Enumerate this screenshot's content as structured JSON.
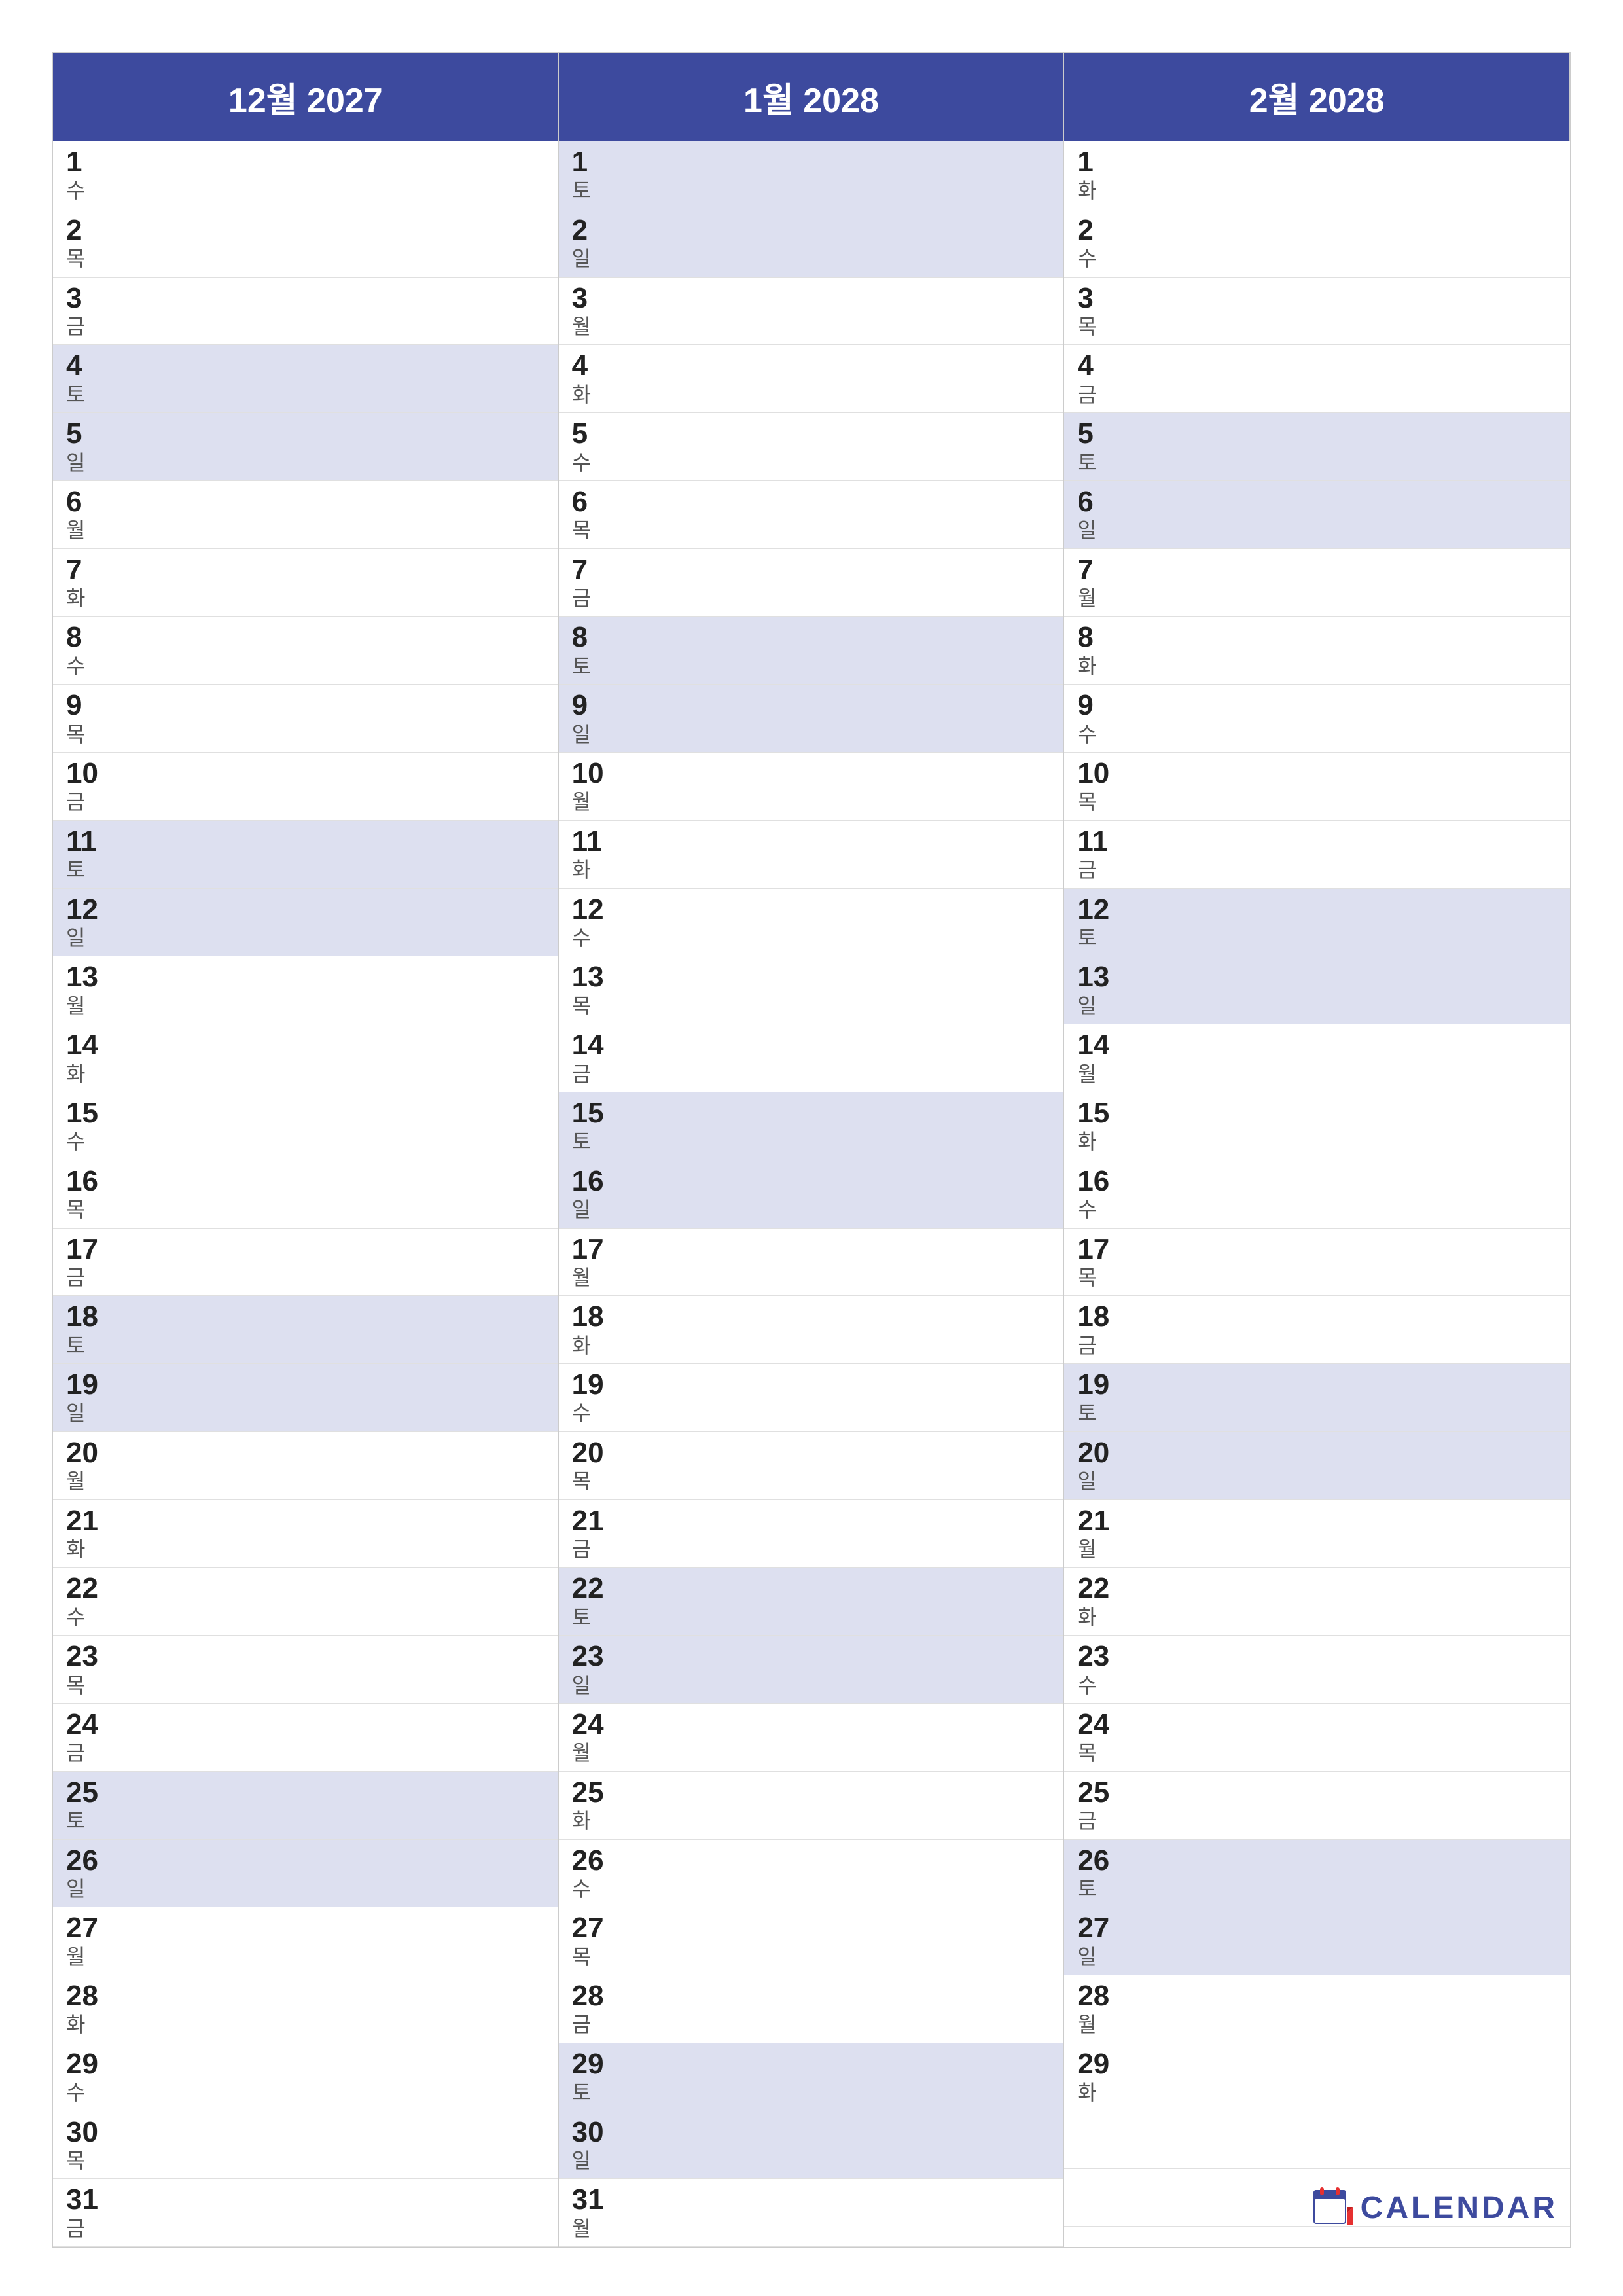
{
  "months": [
    {
      "title": "12월 2027",
      "days": [
        {
          "num": "1",
          "name": "수",
          "weekend": false
        },
        {
          "num": "2",
          "name": "목",
          "weekend": false
        },
        {
          "num": "3",
          "name": "금",
          "weekend": false
        },
        {
          "num": "4",
          "name": "토",
          "weekend": true
        },
        {
          "num": "5",
          "name": "일",
          "weekend": true
        },
        {
          "num": "6",
          "name": "월",
          "weekend": false
        },
        {
          "num": "7",
          "name": "화",
          "weekend": false
        },
        {
          "num": "8",
          "name": "수",
          "weekend": false
        },
        {
          "num": "9",
          "name": "목",
          "weekend": false
        },
        {
          "num": "10",
          "name": "금",
          "weekend": false
        },
        {
          "num": "11",
          "name": "토",
          "weekend": true
        },
        {
          "num": "12",
          "name": "일",
          "weekend": true
        },
        {
          "num": "13",
          "name": "월",
          "weekend": false
        },
        {
          "num": "14",
          "name": "화",
          "weekend": false
        },
        {
          "num": "15",
          "name": "수",
          "weekend": false
        },
        {
          "num": "16",
          "name": "목",
          "weekend": false
        },
        {
          "num": "17",
          "name": "금",
          "weekend": false
        },
        {
          "num": "18",
          "name": "토",
          "weekend": true
        },
        {
          "num": "19",
          "name": "일",
          "weekend": true
        },
        {
          "num": "20",
          "name": "월",
          "weekend": false
        },
        {
          "num": "21",
          "name": "화",
          "weekend": false
        },
        {
          "num": "22",
          "name": "수",
          "weekend": false
        },
        {
          "num": "23",
          "name": "목",
          "weekend": false
        },
        {
          "num": "24",
          "name": "금",
          "weekend": false
        },
        {
          "num": "25",
          "name": "토",
          "weekend": true
        },
        {
          "num": "26",
          "name": "일",
          "weekend": true
        },
        {
          "num": "27",
          "name": "월",
          "weekend": false
        },
        {
          "num": "28",
          "name": "화",
          "weekend": false
        },
        {
          "num": "29",
          "name": "수",
          "weekend": false
        },
        {
          "num": "30",
          "name": "목",
          "weekend": false
        },
        {
          "num": "31",
          "name": "금",
          "weekend": false
        }
      ]
    },
    {
      "title": "1월 2028",
      "days": [
        {
          "num": "1",
          "name": "토",
          "weekend": true
        },
        {
          "num": "2",
          "name": "일",
          "weekend": true
        },
        {
          "num": "3",
          "name": "월",
          "weekend": false
        },
        {
          "num": "4",
          "name": "화",
          "weekend": false
        },
        {
          "num": "5",
          "name": "수",
          "weekend": false
        },
        {
          "num": "6",
          "name": "목",
          "weekend": false
        },
        {
          "num": "7",
          "name": "금",
          "weekend": false
        },
        {
          "num": "8",
          "name": "토",
          "weekend": true
        },
        {
          "num": "9",
          "name": "일",
          "weekend": true
        },
        {
          "num": "10",
          "name": "월",
          "weekend": false
        },
        {
          "num": "11",
          "name": "화",
          "weekend": false
        },
        {
          "num": "12",
          "name": "수",
          "weekend": false
        },
        {
          "num": "13",
          "name": "목",
          "weekend": false
        },
        {
          "num": "14",
          "name": "금",
          "weekend": false
        },
        {
          "num": "15",
          "name": "토",
          "weekend": true
        },
        {
          "num": "16",
          "name": "일",
          "weekend": true
        },
        {
          "num": "17",
          "name": "월",
          "weekend": false
        },
        {
          "num": "18",
          "name": "화",
          "weekend": false
        },
        {
          "num": "19",
          "name": "수",
          "weekend": false
        },
        {
          "num": "20",
          "name": "목",
          "weekend": false
        },
        {
          "num": "21",
          "name": "금",
          "weekend": false
        },
        {
          "num": "22",
          "name": "토",
          "weekend": true
        },
        {
          "num": "23",
          "name": "일",
          "weekend": true
        },
        {
          "num": "24",
          "name": "월",
          "weekend": false
        },
        {
          "num": "25",
          "name": "화",
          "weekend": false
        },
        {
          "num": "26",
          "name": "수",
          "weekend": false
        },
        {
          "num": "27",
          "name": "목",
          "weekend": false
        },
        {
          "num": "28",
          "name": "금",
          "weekend": false
        },
        {
          "num": "29",
          "name": "토",
          "weekend": true
        },
        {
          "num": "30",
          "name": "일",
          "weekend": true
        },
        {
          "num": "31",
          "name": "월",
          "weekend": false
        }
      ]
    },
    {
      "title": "2월 2028",
      "days": [
        {
          "num": "1",
          "name": "화",
          "weekend": false
        },
        {
          "num": "2",
          "name": "수",
          "weekend": false
        },
        {
          "num": "3",
          "name": "목",
          "weekend": false
        },
        {
          "num": "4",
          "name": "금",
          "weekend": false
        },
        {
          "num": "5",
          "name": "토",
          "weekend": true
        },
        {
          "num": "6",
          "name": "일",
          "weekend": true
        },
        {
          "num": "7",
          "name": "월",
          "weekend": false
        },
        {
          "num": "8",
          "name": "화",
          "weekend": false
        },
        {
          "num": "9",
          "name": "수",
          "weekend": false
        },
        {
          "num": "10",
          "name": "목",
          "weekend": false
        },
        {
          "num": "11",
          "name": "금",
          "weekend": false
        },
        {
          "num": "12",
          "name": "토",
          "weekend": true
        },
        {
          "num": "13",
          "name": "일",
          "weekend": true
        },
        {
          "num": "14",
          "name": "월",
          "weekend": false
        },
        {
          "num": "15",
          "name": "화",
          "weekend": false
        },
        {
          "num": "16",
          "name": "수",
          "weekend": false
        },
        {
          "num": "17",
          "name": "목",
          "weekend": false
        },
        {
          "num": "18",
          "name": "금",
          "weekend": false
        },
        {
          "num": "19",
          "name": "토",
          "weekend": true
        },
        {
          "num": "20",
          "name": "일",
          "weekend": true
        },
        {
          "num": "21",
          "name": "월",
          "weekend": false
        },
        {
          "num": "22",
          "name": "화",
          "weekend": false
        },
        {
          "num": "23",
          "name": "수",
          "weekend": false
        },
        {
          "num": "24",
          "name": "목",
          "weekend": false
        },
        {
          "num": "25",
          "name": "금",
          "weekend": false
        },
        {
          "num": "26",
          "name": "토",
          "weekend": true
        },
        {
          "num": "27",
          "name": "일",
          "weekend": true
        },
        {
          "num": "28",
          "name": "월",
          "weekend": false
        },
        {
          "num": "29",
          "name": "화",
          "weekend": false
        }
      ]
    }
  ],
  "logo": {
    "text": "CALENDAR",
    "icon_color": "#e63030"
  }
}
